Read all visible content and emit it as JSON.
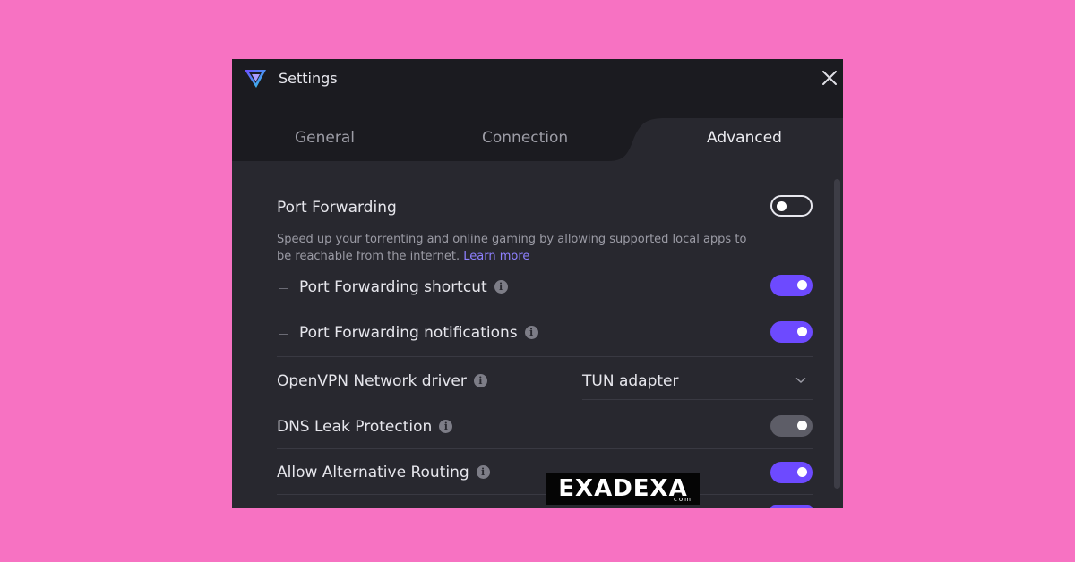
{
  "window": {
    "title": "Settings"
  },
  "tabs": [
    {
      "label": "General",
      "active": false
    },
    {
      "label": "Connection",
      "active": false
    },
    {
      "label": "Advanced",
      "active": true
    }
  ],
  "settings": {
    "port_forwarding": {
      "label": "Port Forwarding",
      "enabled": false,
      "description": "Speed up your torrenting and online gaming by allowing supported local apps to be reachable from the internet.",
      "learn_more": "Learn more"
    },
    "pf_shortcut": {
      "label": "Port Forwarding shortcut",
      "enabled": true
    },
    "pf_notifications": {
      "label": "Port Forwarding notifications",
      "enabled": true
    },
    "openvpn_driver": {
      "label": "OpenVPN Network driver",
      "value": "TUN adapter"
    },
    "dns_leak": {
      "label": "DNS Leak Protection",
      "enabled": true
    },
    "alt_routing": {
      "label": "Allow Alternative Routing",
      "enabled": true
    }
  },
  "watermark": {
    "text": "EXADEXA",
    "sub": "com"
  },
  "icons": {
    "app_logo": "vpn-logo-icon",
    "close": "close-icon",
    "info": "info-icon",
    "dropdown": "chevron-down-icon"
  },
  "colors": {
    "accent": "#6d4aff",
    "window_bg": "#28282f",
    "titlebar_bg": "#1b1b20",
    "page_bg": "#f772c2",
    "link": "#8e80ff"
  }
}
